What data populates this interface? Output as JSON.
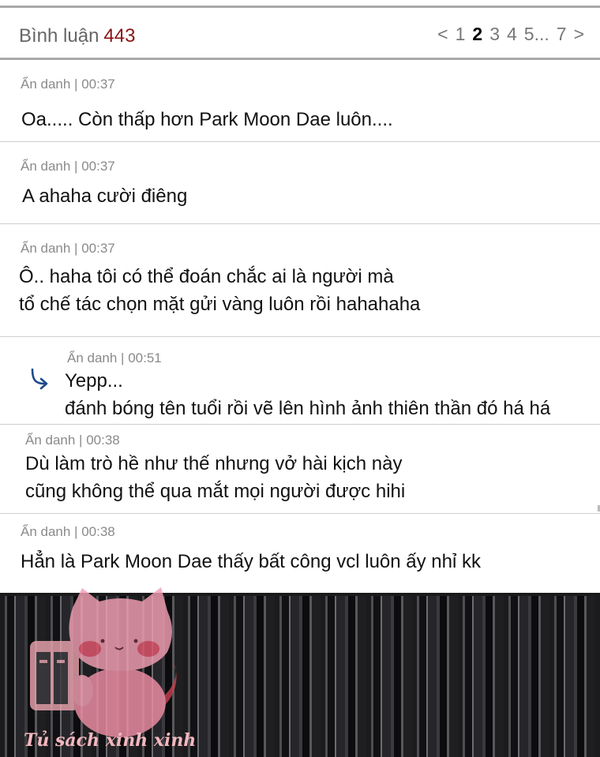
{
  "header": {
    "title": "Bình luận",
    "count": "443",
    "pager": {
      "prev": "<",
      "p1": "1",
      "p2": "2",
      "p3": "3",
      "p4": "4",
      "p5": "5...",
      "p7": "7",
      "next": ">"
    }
  },
  "comments": [
    {
      "meta": "Ẩn danh | 00:37",
      "lines": [
        "Oa..... Còn thấp hơn Park Moon Dae luôn...."
      ]
    },
    {
      "meta": "Ẩn danh | 00:37",
      "lines": [
        "A ahaha cười điêng"
      ]
    },
    {
      "meta": "Ẩn danh | 00:37",
      "lines": [
        "Ô.. haha tôi có thể đoán chắc ai là người mà",
        "tổ chế tác chọn mặt gửi vàng luôn rồi hahahaha"
      ]
    },
    {
      "meta": "Ẩn danh | 00:51",
      "lines": [
        "Yepp...",
        "đánh bóng tên tuổi rồi vẽ lên hình ảnh thiên thần đó há há"
      ]
    },
    {
      "meta": "Ẩn danh | 00:38",
      "lines": [
        "Dù làm trò hề như thế nhưng vở hài kịch này",
        "cũng không thể qua mắt mọi người được hihi"
      ]
    },
    {
      "meta": "Ẩn danh | 00:38",
      "lines": [
        "Hẳn là Park Moon Dae thấy bất công vcl luôn ấy nhỉ kk"
      ]
    }
  ],
  "watermark": {
    "text": "Tủ sách xinh xinh"
  },
  "colors": {
    "accent": "#8a1414",
    "reply_icon": "#1e4a8a",
    "watermark_pink": "#f2a0b4"
  }
}
